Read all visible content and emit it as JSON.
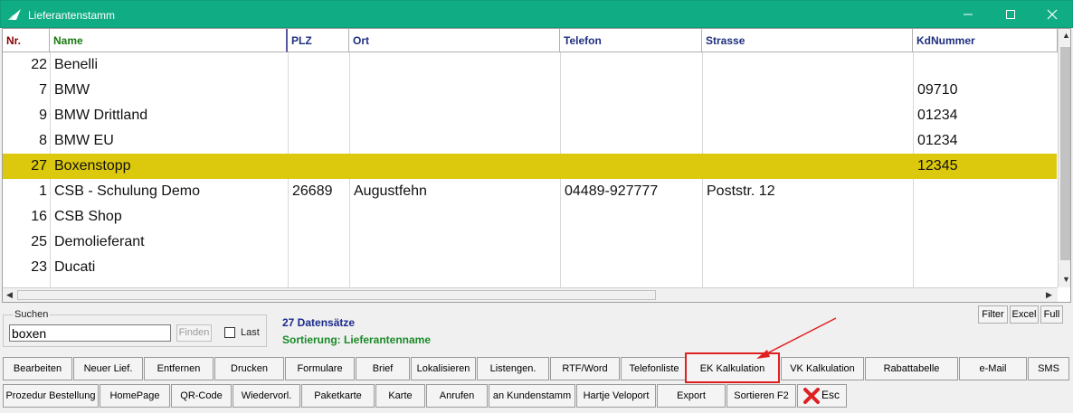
{
  "window": {
    "title": "Lieferantenstamm"
  },
  "columns": [
    "Nr.",
    "Name",
    "PLZ",
    "Ort",
    "Telefon",
    "Strasse",
    "KdNummer"
  ],
  "rows": [
    {
      "nr": "22",
      "name": "Benelli",
      "plz": "",
      "ort": "",
      "telefon": "",
      "strasse": "",
      "kdnummer": ""
    },
    {
      "nr": "7",
      "name": "BMW",
      "plz": "",
      "ort": "",
      "telefon": "",
      "strasse": "",
      "kdnummer": "09710"
    },
    {
      "nr": "9",
      "name": "BMW Drittland",
      "plz": "",
      "ort": "",
      "telefon": "",
      "strasse": "",
      "kdnummer": "01234"
    },
    {
      "nr": "8",
      "name": "BMW EU",
      "plz": "",
      "ort": "",
      "telefon": "",
      "strasse": "",
      "kdnummer": "01234"
    },
    {
      "nr": "27",
      "name": "Boxenstopp",
      "plz": "",
      "ort": "",
      "telefon": "",
      "strasse": "",
      "kdnummer": "12345"
    },
    {
      "nr": "1",
      "name": "CSB - Schulung Demo",
      "plz": "26689",
      "ort": "Augustfehn",
      "telefon": "04489-927777",
      "strasse": "Poststr. 12",
      "kdnummer": ""
    },
    {
      "nr": "16",
      "name": "CSB Shop",
      "plz": "",
      "ort": "",
      "telefon": "",
      "strasse": "",
      "kdnummer": ""
    },
    {
      "nr": "25",
      "name": "Demolieferant",
      "plz": "",
      "ort": "",
      "telefon": "",
      "strasse": "",
      "kdnummer": ""
    },
    {
      "nr": "23",
      "name": "Ducati",
      "plz": "",
      "ort": "",
      "telefon": "",
      "strasse": "",
      "kdnummer": ""
    }
  ],
  "selected_row": 4,
  "search": {
    "legend": "Suchen",
    "value": "boxen",
    "finden_label": "Finden",
    "last_label": "Last"
  },
  "status": {
    "count": "27 Datensätze",
    "sort": "Sortierung: Lieferantenname"
  },
  "side_buttons": [
    "Filter",
    "Excel",
    "Full"
  ],
  "buttons_row1": [
    "Bearbeiten",
    "Neuer Lief.",
    "Entfernen",
    "Drucken",
    "Formulare",
    "Brief",
    "Lokalisieren",
    "Listengen.",
    "RTF/Word",
    "Telefonliste",
    "EK Kalkulation",
    "VK Kalkulation",
    "Rabattabelle",
    "e-Mail",
    "SMS"
  ],
  "buttons_row2": [
    "Prozedur Bestellung",
    "HomePage",
    "QR-Code",
    "Wiedervorl.",
    "Paketkarte",
    "Karte",
    "Anrufen",
    "an Kundenstamm",
    "Hartje Veloport",
    "Export",
    "Sortieren F2",
    "Esc"
  ],
  "colors": {
    "titlebar": "#10ac84",
    "selected_row": "#dcc80c",
    "highlight_box": "#e02020",
    "count_text": "#1a2a8c",
    "sort_text": "#1a8a28"
  }
}
